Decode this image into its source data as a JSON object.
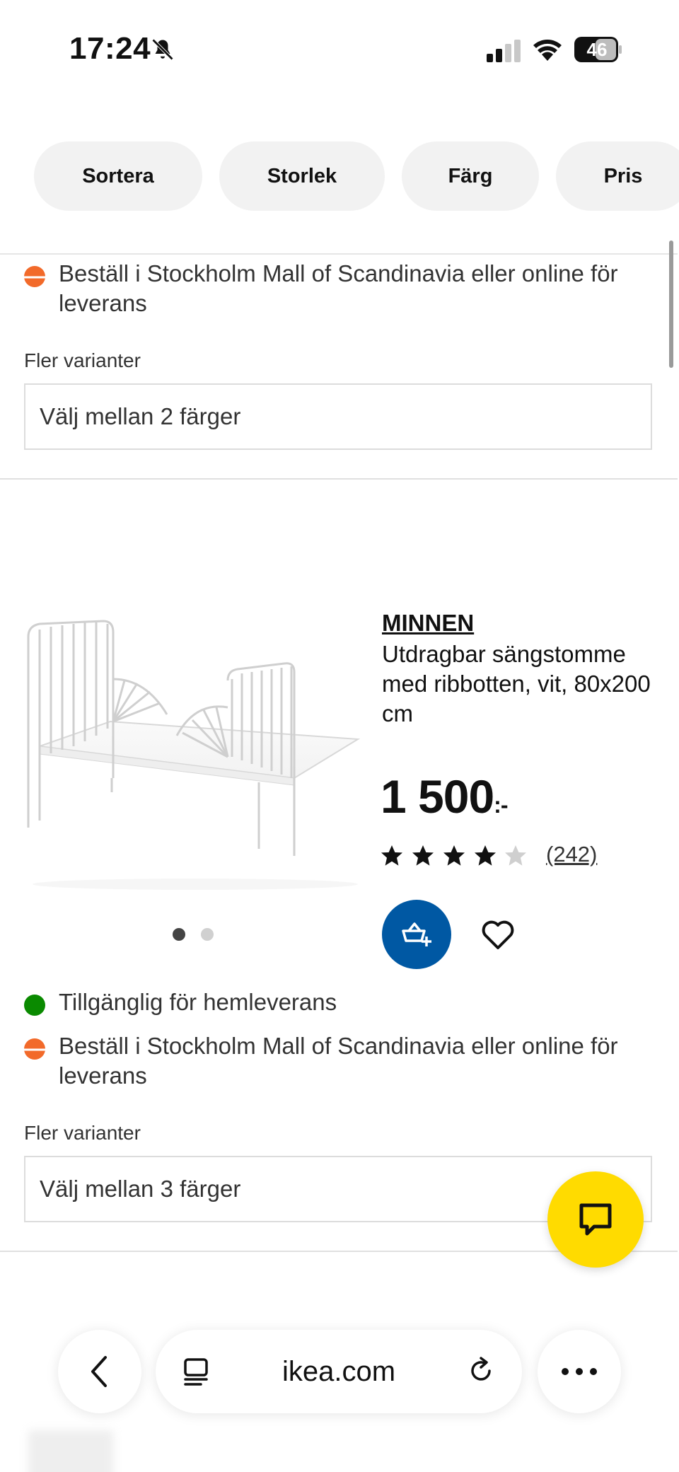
{
  "status_bar": {
    "time": "17:24",
    "battery": "46"
  },
  "filters": [
    {
      "label": "Sortera"
    },
    {
      "label": "Storlek"
    },
    {
      "label": "Färg"
    },
    {
      "label": "Pris"
    }
  ],
  "prev_product": {
    "stock_store": "Beställ i Stockholm Mall of Scandinavia eller online för leverans",
    "variants_label": "Fler varianter",
    "variants_select": "Välj mellan 2 färger"
  },
  "product": {
    "name": "MINNEN",
    "description": "Utdragbar sängstomme med ribbotten, vit, 80x200 cm",
    "price": "1 500",
    "currency": ":-",
    "rating": 4.5,
    "reviews": "(242)",
    "image_count": 2,
    "stock_home": "Tillgänglig för hemleverans",
    "stock_store": "Beställ i Stockholm Mall of Scandinavia eller online för leverans",
    "variants_label": "Fler varianter",
    "variants_select": "Välj mellan 3 färger"
  },
  "browser": {
    "url": "ikea.com"
  },
  "colors": {
    "brand_blue": "#0058a3",
    "chat_yellow": "#ffdb00",
    "available_green": "#0a8a00",
    "store_orange": "#f26a2a"
  }
}
